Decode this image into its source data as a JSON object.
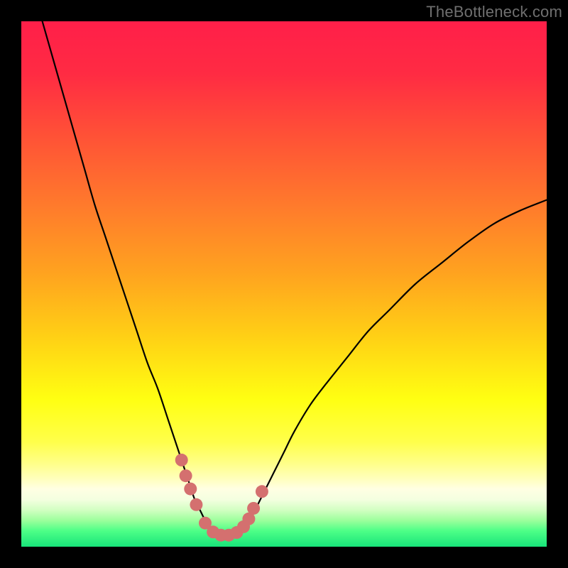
{
  "watermark": "TheBottleneck.com",
  "gradient_stops": [
    {
      "pct": 0,
      "color": "#ff1f49"
    },
    {
      "pct": 10,
      "color": "#ff2b43"
    },
    {
      "pct": 22,
      "color": "#ff5236"
    },
    {
      "pct": 35,
      "color": "#ff7a2c"
    },
    {
      "pct": 48,
      "color": "#ffa31f"
    },
    {
      "pct": 60,
      "color": "#ffd015"
    },
    {
      "pct": 72,
      "color": "#ffff12"
    },
    {
      "pct": 80,
      "color": "#ffff4a"
    },
    {
      "pct": 84,
      "color": "#ffff86"
    },
    {
      "pct": 87,
      "color": "#ffffbb"
    },
    {
      "pct": 89,
      "color": "#ffffe3"
    },
    {
      "pct": 91,
      "color": "#f4ffe0"
    },
    {
      "pct": 93,
      "color": "#d2ffc2"
    },
    {
      "pct": 95,
      "color": "#9cff9c"
    },
    {
      "pct": 97,
      "color": "#4dff87"
    },
    {
      "pct": 100,
      "color": "#18e47a"
    }
  ],
  "curve_color": "#000000",
  "curve_width": 2.2,
  "marker_color": "#d4706f",
  "marker_radius": 9,
  "chart_data": {
    "type": "line",
    "title": "",
    "xlabel": "",
    "ylabel": "",
    "xlim": [
      0,
      100
    ],
    "ylim": [
      0,
      100
    ],
    "grid": false,
    "series": [
      {
        "name": "bottleneck-curve",
        "x": [
          4,
          6,
          8,
          10,
          12,
          14,
          16,
          18,
          20,
          22,
          24,
          26,
          28,
          30,
          31,
          32,
          33,
          34,
          35,
          36,
          37,
          38,
          39,
          40,
          41,
          42,
          43,
          44,
          46,
          48,
          50,
          52,
          55,
          58,
          62,
          66,
          70,
          75,
          80,
          85,
          90,
          95,
          100
        ],
        "y": [
          100,
          93,
          86,
          79,
          72,
          65,
          59,
          53,
          47,
          41,
          35,
          30,
          24,
          18,
          15,
          12,
          9,
          7,
          5,
          3.5,
          2.5,
          2,
          2,
          2,
          2.3,
          3,
          4.2,
          6,
          10,
          14,
          18,
          22,
          27,
          31,
          36,
          41,
          45,
          50,
          54,
          58,
          61.5,
          64,
          66
        ]
      }
    ],
    "markers": {
      "name": "highlight-dots",
      "x": [
        30.5,
        31.3,
        32.2,
        33.3,
        35.0,
        36.5,
        38.0,
        39.5,
        41.0,
        42.3,
        43.3,
        44.2,
        45.8
      ],
      "y": [
        16.5,
        13.5,
        11.0,
        8.0,
        4.5,
        2.8,
        2.2,
        2.2,
        2.7,
        3.8,
        5.3,
        7.3,
        10.5
      ]
    }
  }
}
